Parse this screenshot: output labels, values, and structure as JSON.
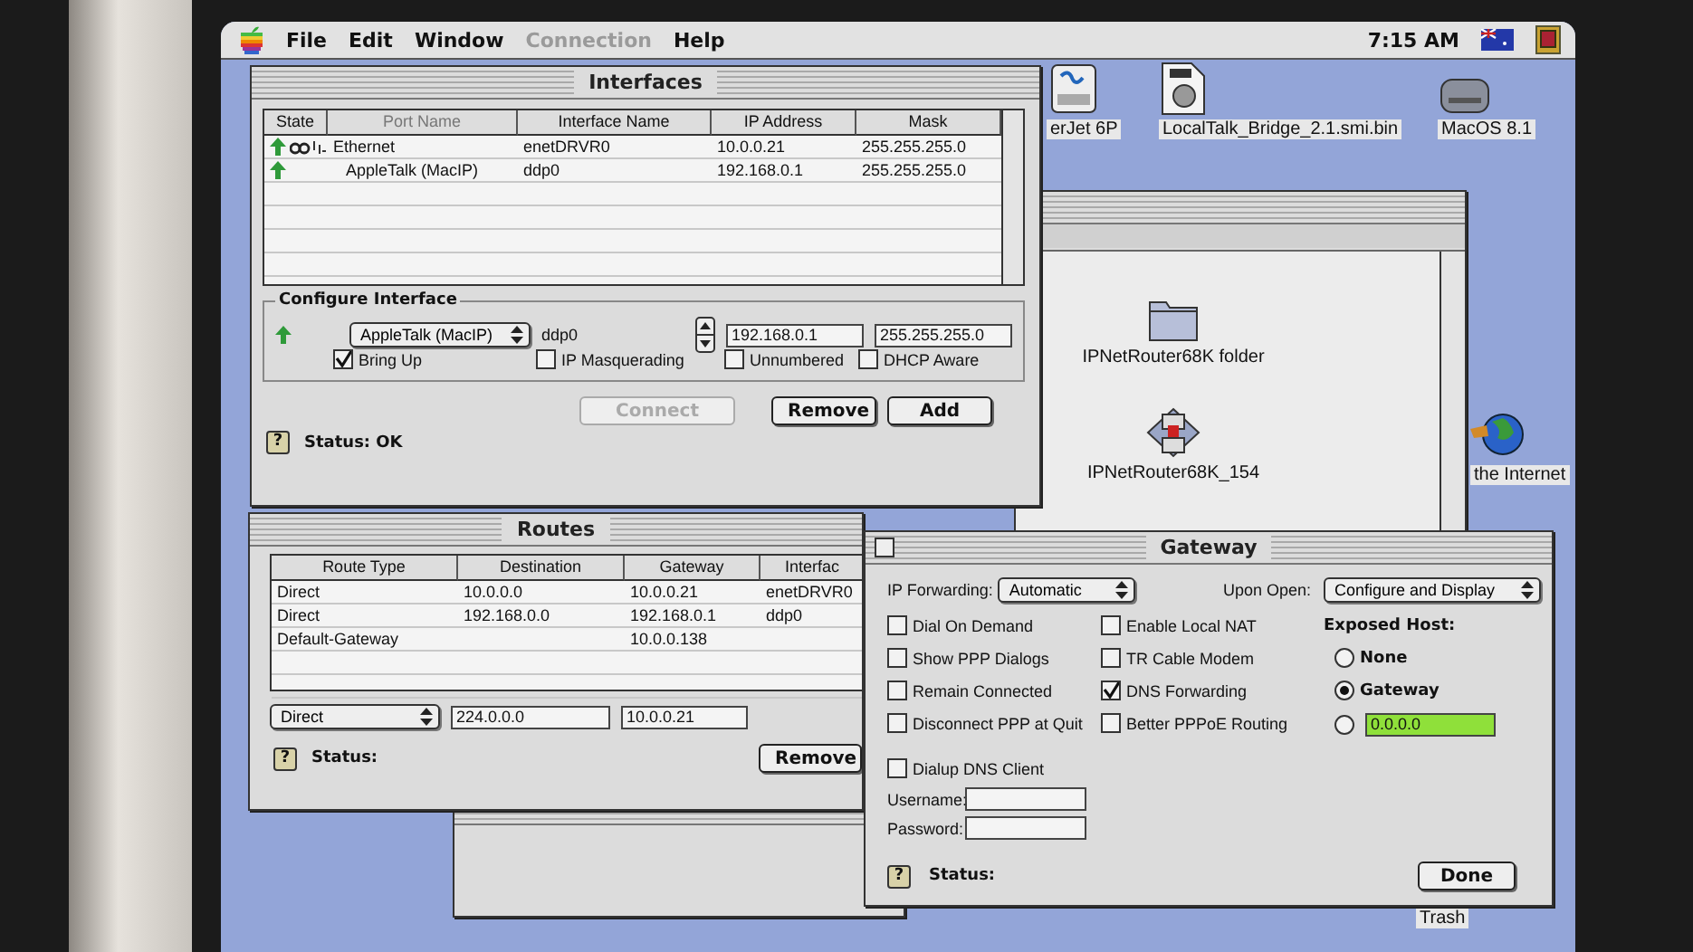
{
  "menu_bar": {
    "items": [
      {
        "label": "File",
        "disabled": false
      },
      {
        "label": "Edit",
        "disabled": false
      },
      {
        "label": "Window",
        "disabled": false
      },
      {
        "label": "Connection",
        "disabled": true
      },
      {
        "label": "Help",
        "disabled": false
      }
    ],
    "clock": "7:15 AM"
  },
  "desktop_icons": [
    {
      "label": "erJet 6P",
      "kind": "printer"
    },
    {
      "label": "LocalTalk_Bridge_2.1.smi.bin",
      "kind": "disk-image"
    },
    {
      "label": "MacOS 8.1",
      "kind": "disk"
    },
    {
      "label": "the Internet",
      "kind": "globe"
    },
    {
      "label": "Trash",
      "kind": "trash"
    }
  ],
  "finder_window": {
    "items": [
      {
        "label": "IPNetRouter68K folder",
        "kind": "folder"
      },
      {
        "label": "IPNetRouter68K_154",
        "kind": "application"
      }
    ]
  },
  "interfaces_window": {
    "title": "Interfaces",
    "columns": [
      "State",
      "Port Name",
      "Interface Name",
      "IP Address",
      "Mask"
    ],
    "rows": [
      {
        "up": true,
        "link_active": true,
        "port_name": "Ethernet",
        "interface_name": "enetDRVR0",
        "ip_address": "10.0.0.21",
        "mask": "255.255.255.0"
      },
      {
        "up": true,
        "link_active": false,
        "port_name": "AppleTalk (MacIP)",
        "interface_name": "ddp0",
        "ip_address": "192.168.0.1",
        "mask": "255.255.255.0"
      }
    ],
    "configure": {
      "label": "Configure Interface",
      "up": true,
      "port": "AppleTalk (MacIP)",
      "interface_name": "ddp0",
      "ip_address": "192.168.0.1",
      "mask": "255.255.255.0",
      "checkboxes": [
        {
          "label": "Bring Up",
          "checked": true
        },
        {
          "label": "IP Masquerading",
          "checked": false
        },
        {
          "label": "Unnumbered",
          "checked": false
        },
        {
          "label": "DHCP Aware",
          "checked": false
        }
      ]
    },
    "buttons": [
      {
        "label": "Connect",
        "disabled": true
      },
      {
        "label": "Remove",
        "disabled": false
      },
      {
        "label": "Add",
        "disabled": false
      }
    ],
    "help": "?",
    "status": "Status: OK"
  },
  "routes_window": {
    "title": "Routes",
    "columns": [
      "Route Type",
      "Destination",
      "Gateway",
      "Interfac"
    ],
    "rows": [
      {
        "route_type": "Direct",
        "destination": "10.0.0.0",
        "gateway": "10.0.0.21",
        "interface": "enetDRVR0"
      },
      {
        "route_type": "Direct",
        "destination": "192.168.0.0",
        "gateway": "192.168.0.1",
        "interface": "ddp0"
      },
      {
        "route_type": "Default-Gateway",
        "gateway": "10.0.0.138"
      }
    ],
    "route_type_popup": "Direct",
    "destination_field": "224.0.0.0",
    "gateway_field": "10.0.0.21",
    "help": "?",
    "status": "Status:",
    "buttons": [
      {
        "label": "Remove"
      }
    ]
  },
  "gateway_window": {
    "title": "Gateway",
    "ip_forwarding_label": "IP Forwarding:",
    "ip_forwarding": "Automatic",
    "upon_open_label": "Upon Open:",
    "upon_open": "Configure and Display",
    "checkbox_columns": [
      [
        {
          "label": "Dial On Demand",
          "checked": false
        },
        {
          "label": "Show PPP Dialogs",
          "checked": false
        },
        {
          "label": "Remain Connected",
          "checked": false
        },
        {
          "label": "Disconnect PPP at Quit",
          "checked": false
        }
      ],
      [
        {
          "label": "Enable Local NAT",
          "checked": false
        },
        {
          "label": "TR Cable Modem",
          "checked": false
        },
        {
          "label": "DNS Forwarding",
          "checked": true
        },
        {
          "label": "Better PPPoE Routing",
          "checked": false
        }
      ]
    ],
    "exposed_host": {
      "label": "Exposed Host:",
      "options": [
        {
          "kind": "label",
          "label": "None",
          "selected": false
        },
        {
          "kind": "label",
          "label": "Gateway",
          "selected": true
        },
        {
          "kind": "address",
          "value": "0.0.0.0",
          "selected": false
        }
      ]
    },
    "dialup_dns": {
      "label": "Dialup DNS Client",
      "checked": false
    },
    "username_label": "Username:",
    "password_label": "Password:",
    "help": "?",
    "status": "Status:",
    "done": "Done"
  }
}
